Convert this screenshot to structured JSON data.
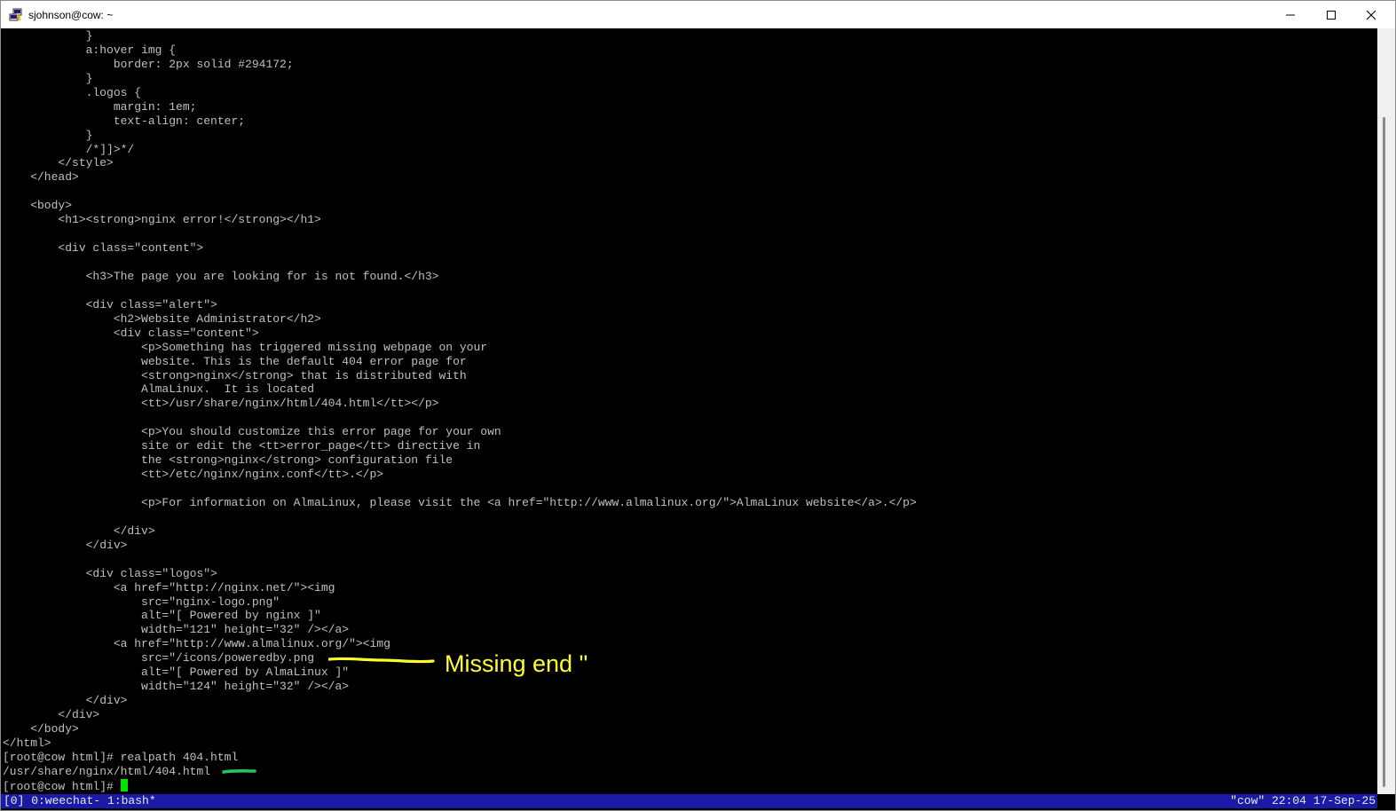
{
  "window": {
    "title": "sjohnson@cow: ~",
    "icon": "putty-terminal-icon"
  },
  "terminal": {
    "lines": [
      "            }",
      "            a:hover img {",
      "                border: 2px solid #294172;",
      "            }",
      "            .logos {",
      "                margin: 1em;",
      "                text-align: center;",
      "            }",
      "            /*]]>*/",
      "        </style>",
      "    </head>",
      "",
      "    <body>",
      "        <h1><strong>nginx error!</strong></h1>",
      "",
      "        <div class=\"content\">",
      "",
      "            <h3>The page you are looking for is not found.</h3>",
      "",
      "            <div class=\"alert\">",
      "                <h2>Website Administrator</h2>",
      "                <div class=\"content\">",
      "                    <p>Something has triggered missing webpage on your",
      "                    website. This is the default 404 error page for",
      "                    <strong>nginx</strong> that is distributed with",
      "                    AlmaLinux.  It is located",
      "                    <tt>/usr/share/nginx/html/404.html</tt></p>",
      "",
      "                    <p>You should customize this error page for your own",
      "                    site or edit the <tt>error_page</tt> directive in",
      "                    the <strong>nginx</strong> configuration file",
      "                    <tt>/etc/nginx/nginx.conf</tt>.</p>",
      "",
      "                    <p>For information on AlmaLinux, please visit the <a href=\"http://www.almalinux.org/\">AlmaLinux website</a>.</p>",
      "",
      "                </div>",
      "            </div>",
      "",
      "            <div class=\"logos\">",
      "                <a href=\"http://nginx.net/\"><img",
      "                    src=\"nginx-logo.png\"",
      "                    alt=\"[ Powered by nginx ]\"",
      "                    width=\"121\" height=\"32\" /></a>",
      "                <a href=\"http://www.almalinux.org/\"><img",
      "                    src=\"/icons/poweredby.png",
      "                    alt=\"[ Powered by AlmaLinux ]\"",
      "                    width=\"124\" height=\"32\" /></a>",
      "            </div>",
      "        </div>",
      "    </body>",
      "</html>",
      "[root@cow html]# realpath 404.html",
      "/usr/share/nginx/html/404.html"
    ],
    "prompt": "[root@cow html]# "
  },
  "statusbar": {
    "left": "[0] 0:weechat- 1:bash*",
    "right": "\"cow\" 22:04 17-Sep-25"
  },
  "annotation": {
    "text": "Missing end \"",
    "color": "#ffff2e",
    "marker_color": "#22c55e"
  }
}
